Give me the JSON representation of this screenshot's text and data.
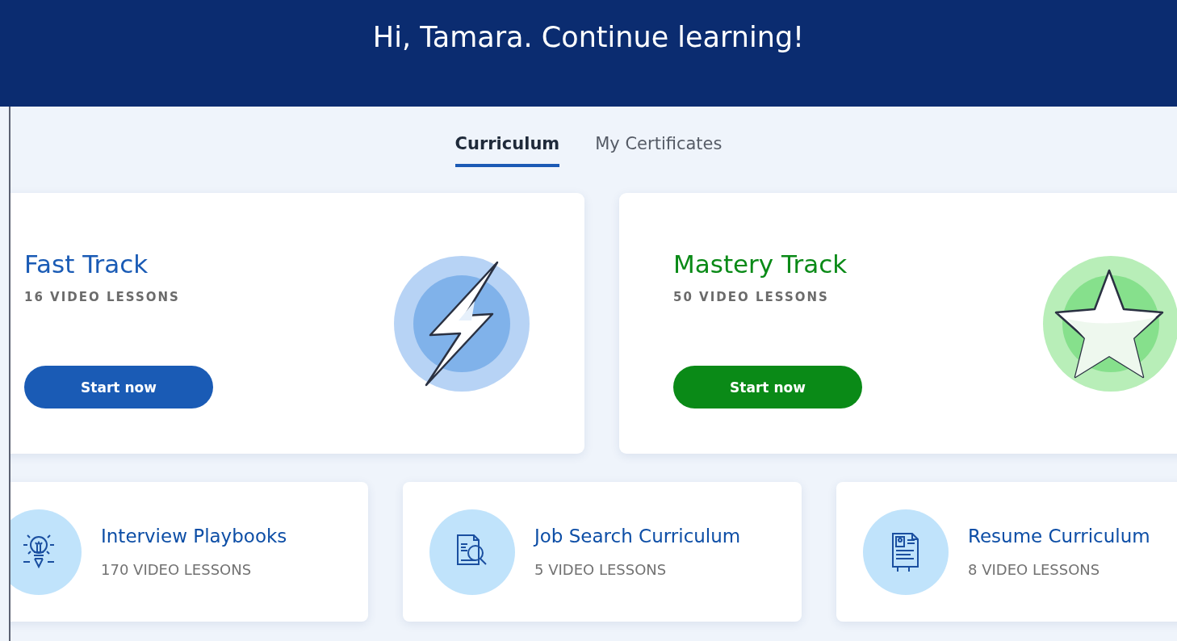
{
  "header": {
    "title": "Hi, Tamara. Continue learning!"
  },
  "tabs": [
    {
      "label": "Curriculum",
      "selected": true
    },
    {
      "label": "My Certificates",
      "selected": false
    }
  ],
  "tracks": [
    {
      "kind": "fast",
      "title": "Fast Track",
      "lessons": "16 VIDEO LESSONS",
      "button": "Start now"
    },
    {
      "kind": "mastery",
      "title": "Mastery Track",
      "lessons": "50 VIDEO LESSONS",
      "button": "Start now"
    }
  ],
  "courses": [
    {
      "kind": "bulb",
      "title": "Interview Playbooks",
      "lessons": "170 VIDEO LESSONS"
    },
    {
      "kind": "search",
      "title": "Job Search Curriculum",
      "lessons": "5 VIDEO LESSONS"
    },
    {
      "kind": "resume",
      "title": "Resume Curriculum",
      "lessons": "8 VIDEO LESSONS"
    }
  ]
}
